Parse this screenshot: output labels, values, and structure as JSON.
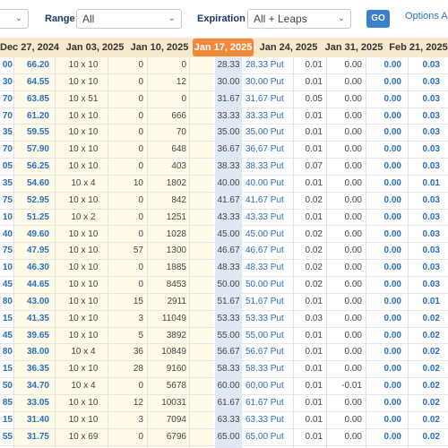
{
  "filters": {
    "first_select_value": "",
    "range_label": "Range",
    "range_value": "All",
    "expiration_label": "Expiration",
    "expiration_value": "All + Leaps",
    "go_label": "GO",
    "options_link": "Options Ap"
  },
  "date_tabs": [
    {
      "label": "Dec 27, 2024",
      "active": false
    },
    {
      "label": "Jan 03, 2025",
      "active": false
    },
    {
      "label": "Jan 10, 2025",
      "active": false
    },
    {
      "label": "Jan 17, 2025",
      "active": true
    },
    {
      "label": "Jan 24, 2025",
      "active": false
    },
    {
      "label": "Jan 31, 2025",
      "active": false
    },
    {
      "label": "Feb 21, 2025",
      "active": false
    }
  ],
  "rows": [
    {
      "a": "00",
      "b": "66.20",
      "size": "10 x 10",
      "c": "0",
      "d": "0",
      "strike": "28.33",
      "put": "28.33 Put",
      "e": "0.01",
      "f": "0.00",
      "g": "0.00",
      "h": "0.03"
    },
    {
      "a": "30",
      "b": "64.55",
      "size": "10 x 10",
      "c": "0",
      "d": "12",
      "strike": "30.00",
      "put": "30.00 Put",
      "e": "0.01",
      "f": "0.00",
      "g": "0.00",
      "h": "0.03"
    },
    {
      "a": "70",
      "b": "63.85",
      "size": "10 x 51",
      "c": "0",
      "d": "0",
      "strike": "31.67",
      "put": "31.67 Put",
      "e": "0.05",
      "f": "0.00",
      "g": "0.00",
      "h": "0.03"
    },
    {
      "a": "70",
      "b": "61.20",
      "size": "10 x 10",
      "c": "0",
      "d": "666",
      "strike": "33.33",
      "put": "33.33 Put",
      "e": "0.01",
      "f": "0.00",
      "g": "0.00",
      "h": "0.03"
    },
    {
      "a": "35",
      "b": "59.55",
      "size": "10 x 10",
      "c": "0",
      "d": "70",
      "strike": "35.00",
      "put": "35.00 Put",
      "e": "0.01",
      "f": "0.00",
      "g": "0.00",
      "h": "0.03"
    },
    {
      "a": "70",
      "b": "57.90",
      "size": "10 x 10",
      "c": "0",
      "d": "648",
      "strike": "36.67",
      "put": "36.67 Put",
      "e": "0.01",
      "f": "0.00",
      "g": "0.00",
      "h": "0.03"
    },
    {
      "a": "05",
      "b": "56.25",
      "size": "10 x 10",
      "c": "0",
      "d": "403",
      "strike": "38.33",
      "put": "38.33 Put",
      "e": "0.07",
      "f": "0.00",
      "g": "0.00",
      "h": "0.03"
    },
    {
      "a": "35",
      "b": "54.60",
      "size": "10 x 4",
      "c": "10",
      "d": "1802",
      "strike": "40.00",
      "put": "40.00 Put",
      "e": "0.01",
      "f": "0.00",
      "g": "0.00",
      "h": "0.01"
    },
    {
      "a": "75",
      "b": "52.95",
      "size": "10 x 10",
      "c": "0",
      "d": "842",
      "strike": "41.67",
      "put": "41.67 Put",
      "e": "0.02",
      "f": "0.00",
      "g": "0.00",
      "h": "0.03"
    },
    {
      "a": "10",
      "b": "51.25",
      "size": "10 x 2",
      "c": "0",
      "d": "1251",
      "strike": "43.33",
      "put": "43.33 Put",
      "e": "0.01",
      "f": "0.00",
      "g": "0.00",
      "h": "0.03"
    },
    {
      "a": "40",
      "b": "49.60",
      "size": "10 x 10",
      "c": "0",
      "d": "1028",
      "strike": "45.00",
      "put": "45.00 Put",
      "e": "0.02",
      "f": "0.00",
      "g": "0.00",
      "h": "0.03"
    },
    {
      "a": "75",
      "b": "47.95",
      "size": "10 x 10",
      "c": "57",
      "d": "1300",
      "strike": "46.67",
      "put": "46.67 Put",
      "e": "0.02",
      "f": "0.00",
      "g": "0.00",
      "h": "0.03"
    },
    {
      "a": "10",
      "b": "46.30",
      "size": "10 x 10",
      "c": "0",
      "d": "1885",
      "strike": "48.33",
      "put": "48.33 Put",
      "e": "0.02",
      "f": "0.00",
      "g": "0.00",
      "h": "0.03"
    },
    {
      "a": "45",
      "b": "44.65",
      "size": "10 x 10",
      "c": "0",
      "d": "8453",
      "strike": "50.00",
      "put": "50.00 Put",
      "e": "0.02",
      "f": "0.00",
      "g": "0.00",
      "h": "0.03"
    },
    {
      "a": "80",
      "b": "43.00",
      "size": "10 x 10",
      "c": "15",
      "d": "2911",
      "strike": "51.67",
      "put": "51.67 Put",
      "e": "0.01",
      "f": "0.00",
      "g": "0.00",
      "h": "0.01"
    },
    {
      "a": "15",
      "b": "41.35",
      "size": "10 x 10",
      "c": "3",
      "d": "11049",
      "strike": "53.33",
      "put": "53.33 Put",
      "e": "0.03",
      "f": "0.00",
      "g": "0.00",
      "h": "0.02"
    },
    {
      "a": "45",
      "b": "39.65",
      "size": "10 x 10",
      "c": "5",
      "d": "3892",
      "strike": "55.00",
      "put": "55.00 Put",
      "e": "0.01",
      "f": "0.00",
      "g": "0.00",
      "h": "0.02"
    },
    {
      "a": "80",
      "b": "38.00",
      "size": "10 x 4",
      "c": "36",
      "d": "10849",
      "strike": "56.67",
      "put": "56.67 Put",
      "e": "0.01",
      "f": "0.00",
      "g": "0.00",
      "h": "0.02"
    },
    {
      "a": "15",
      "b": "36.35",
      "size": "10 x 10",
      "c": "28",
      "d": "9160",
      "strike": "58.33",
      "put": "58.33 Put",
      "e": "0.01",
      "f": "0.00",
      "g": "0.00",
      "h": "0.02"
    },
    {
      "a": "50",
      "b": "34.70",
      "size": "10 x 4",
      "c": "0",
      "d": "5678",
      "strike": "60.00",
      "put": "60.00 Put",
      "e": "0.01",
      "f": "-0.01",
      "g": "0.00",
      "h": "0.02"
    },
    {
      "a": "85",
      "b": "33.05",
      "size": "10 x 10",
      "c": "12",
      "d": "10031",
      "strike": "61.67",
      "put": "61.67 Put",
      "e": "0.01",
      "f": "0.00",
      "g": "0.00",
      "h": "0.02"
    },
    {
      "a": "15",
      "b": "31.40",
      "size": "10 x 10",
      "c": "3",
      "d": "7094",
      "strike": "63.33",
      "put": "63.33 Put",
      "e": "0.01",
      "f": "0.00",
      "g": "0.00",
      "h": "0.02"
    },
    {
      "a": "55",
      "b": "31.75",
      "size": "10 x 69",
      "c": "0",
      "d": "6796",
      "strike": "65.00",
      "put": "65.00 Put",
      "e": "0.01",
      "f": "0.00",
      "g": "0.00",
      "h": "0.02"
    }
  ]
}
